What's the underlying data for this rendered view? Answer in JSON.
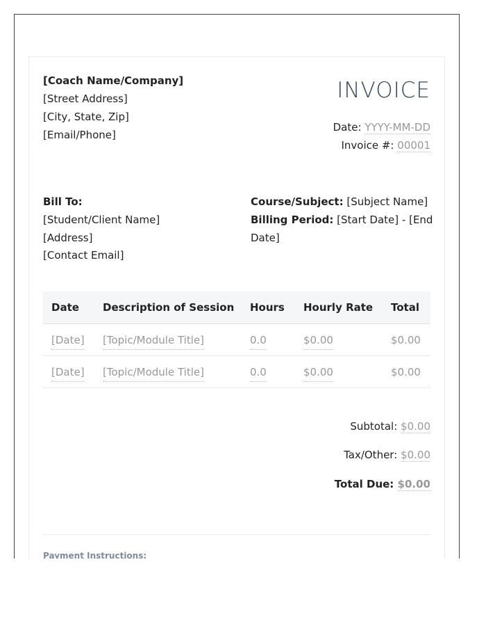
{
  "from": {
    "name": "[Coach Name/Company]",
    "street": "[Street Address]",
    "city": "[City, State, Zip]",
    "contact": "[Email/Phone]"
  },
  "invoice": {
    "title": "INVOICE",
    "date_label": "Date:",
    "date_value": "YYYY-MM-DD",
    "number_label": "Invoice #:",
    "number_value": "00001"
  },
  "bill_to": {
    "heading": "Bill To:",
    "name": "[Student/Client Name]",
    "address": "[Address]",
    "email": "[Contact Email]"
  },
  "course": {
    "subject_label": "Course/Subject:",
    "subject_value": "[Subject Name]",
    "period_label": "Billing Period:",
    "period_value_line1": "[Start Date] - [End",
    "period_value_line2": "Date]"
  },
  "table": {
    "headers": [
      "Date",
      "Description of Session",
      "Hours",
      "Hourly Rate",
      "Total"
    ],
    "rows": [
      [
        "[Date]",
        "[Topic/Module Title]",
        "0.0",
        "$0.00",
        "$0.00"
      ],
      [
        "[Date]",
        "[Topic/Module Title]",
        "0.0",
        "$0.00",
        "$0.00"
      ]
    ]
  },
  "totals": {
    "subtotal_label": "Subtotal:",
    "subtotal_value": "$0.00",
    "tax_label": "Tax/Other:",
    "tax_value": "$0.00",
    "total_label": "Total Due:",
    "total_value": "$0.00"
  },
  "payment": {
    "heading": "Payment Instructions:"
  },
  "colors": {
    "title": "#34495e",
    "muted": "#999999",
    "header_bg": "#f4f6f8"
  }
}
